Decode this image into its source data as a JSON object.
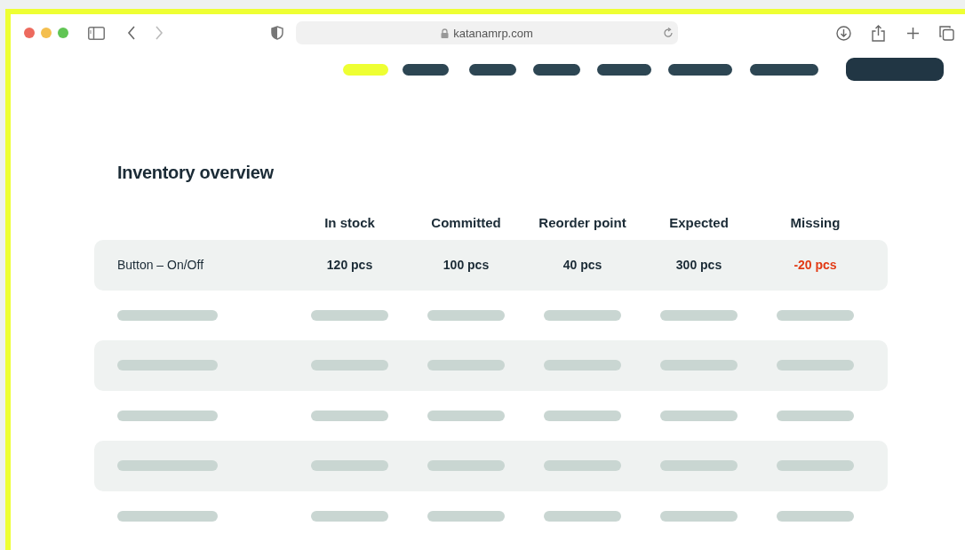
{
  "browser": {
    "url": "katanamrp.com"
  },
  "nav": {
    "items": [
      {
        "selected": true
      },
      {
        "selected": false
      },
      {
        "selected": false
      },
      {
        "selected": false
      },
      {
        "selected": false
      },
      {
        "selected": false
      },
      {
        "selected": false
      }
    ]
  },
  "title": "Inventory overview",
  "table": {
    "columns": [
      "In stock",
      "Committed",
      "Reorder point",
      "Expected",
      "Missing"
    ],
    "rows": [
      {
        "kind": "item",
        "name": "Button – On/Off",
        "cells": [
          {
            "text": "120 pcs",
            "alert": false
          },
          {
            "text": "100 pcs",
            "alert": false
          },
          {
            "text": "40 pcs",
            "alert": false
          },
          {
            "text": "300 pcs",
            "alert": false
          },
          {
            "text": "-20 pcs",
            "alert": true
          }
        ]
      },
      {
        "kind": "placeholder"
      },
      {
        "kind": "placeholder"
      },
      {
        "kind": "placeholder"
      },
      {
        "kind": "placeholder"
      },
      {
        "kind": "placeholder"
      }
    ]
  }
}
